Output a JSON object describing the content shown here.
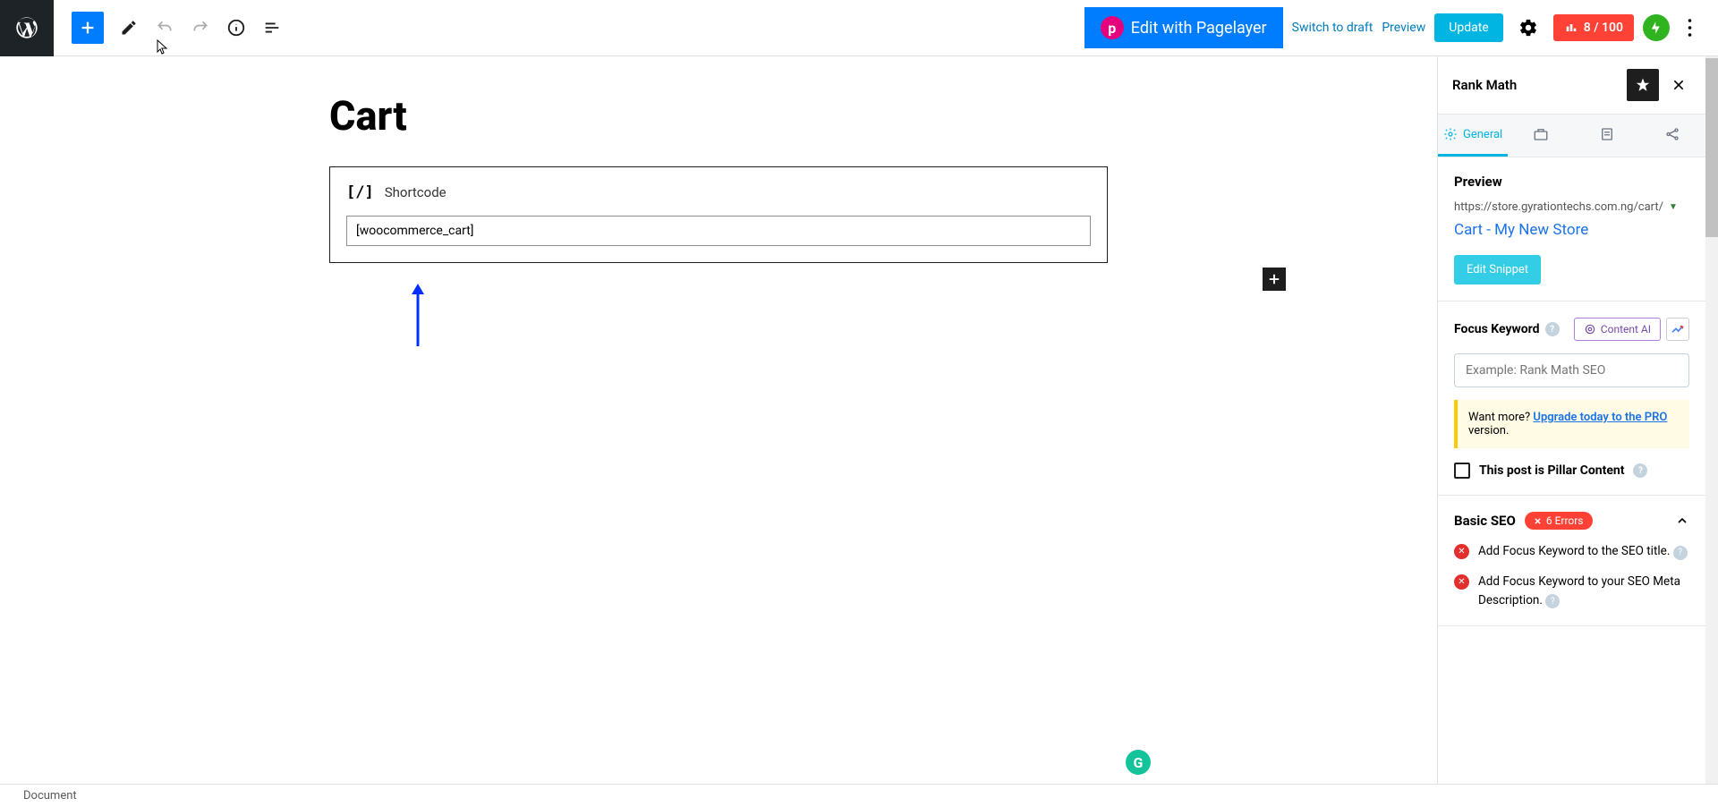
{
  "toolbar": {
    "pagelayer_label": "Edit with Pagelayer",
    "switch_draft": "Switch to draft",
    "preview": "Preview",
    "update": "Update",
    "score": "8 / 100"
  },
  "editor": {
    "page_title": "Cart",
    "block_label": "Shortcode",
    "shortcode_value": "[woocommerce_cart]"
  },
  "sidebar": {
    "title": "Rank Math",
    "tabs": {
      "general": "General"
    },
    "preview": {
      "heading": "Preview",
      "url": "https://store.gyrationtechs.com.ng/cart/",
      "title_link": "Cart - My New Store",
      "edit_snippet": "Edit Snippet"
    },
    "focus_keyword": {
      "label": "Focus Keyword",
      "content_ai": "Content AI",
      "placeholder": "Example: Rank Math SEO"
    },
    "promo": {
      "prefix": "Want more? ",
      "link": "Upgrade today to the PRO",
      "suffix": " version."
    },
    "pillar_label": "This post is Pillar Content",
    "basic_seo": {
      "heading": "Basic SEO",
      "badge": "6 Errors",
      "errors": [
        "Add Focus Keyword to the SEO title.",
        "Add Focus Keyword to your SEO Meta Description."
      ]
    }
  },
  "footer": {
    "breadcrumb": "Document"
  }
}
